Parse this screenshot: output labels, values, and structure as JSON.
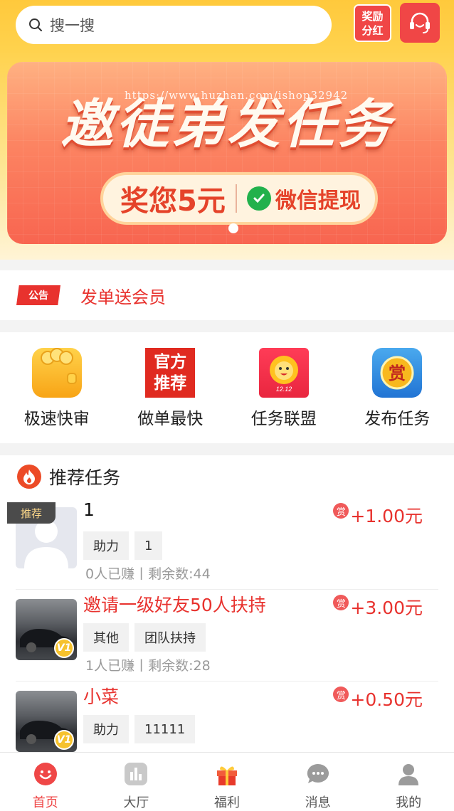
{
  "search": {
    "placeholder": "搜一搜"
  },
  "reward": {
    "line1": "奖励",
    "line2": "分红"
  },
  "banner": {
    "title": "邀徒弟发任务",
    "amount_text": "奖您5元",
    "wechat_text": "微信提现",
    "watermark": "https://www.huzhan.com/ishop32942"
  },
  "notice": {
    "tag": "公告",
    "text": "发单送会员"
  },
  "quick": [
    {
      "label": "极速快审"
    },
    {
      "label": "做单最快",
      "icon_text": [
        "官方",
        "推荐"
      ]
    },
    {
      "label": "任务联盟",
      "icon_text": "12.12"
    },
    {
      "label": "发布任务",
      "icon_text": "赏"
    }
  ],
  "recommend": {
    "title": "推荐任务",
    "badge": "推荐",
    "tasks": [
      {
        "title": "1",
        "tags": [
          "助力",
          "1"
        ],
        "stats": "0人已赚丨剩余数:44",
        "reward_icon": "赏",
        "amount": "+1.00元"
      },
      {
        "title": "邀请一级好友50人扶持",
        "tags": [
          "其他",
          "团队扶持"
        ],
        "stats": "1人已赚丨剩余数:28",
        "reward_icon": "赏",
        "amount": "+3.00元",
        "level": "V1"
      },
      {
        "title": "小菜",
        "tags": [
          "助力",
          "11111"
        ],
        "stats": "",
        "reward_icon": "赏",
        "amount": "+0.50元",
        "level": "V1"
      }
    ]
  },
  "tabs": [
    {
      "label": "首页",
      "icon": "home-icon",
      "active": true
    },
    {
      "label": "大厅",
      "icon": "hall-icon"
    },
    {
      "label": "福利",
      "icon": "gift-icon"
    },
    {
      "label": "消息",
      "icon": "message-icon"
    },
    {
      "label": "我的",
      "icon": "profile-icon"
    }
  ],
  "colors": {
    "accent": "#e8322e",
    "header": "#ffc93c",
    "tab_active": "#ef4747"
  }
}
